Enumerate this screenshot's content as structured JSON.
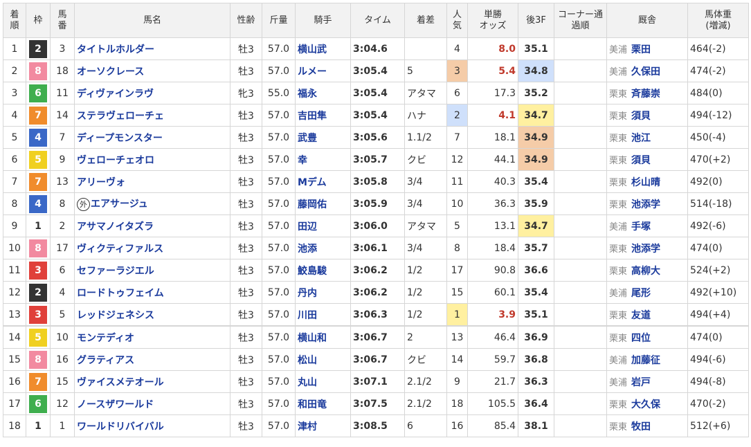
{
  "headers": {
    "pos": "着順",
    "waku": "枠",
    "num": "馬番",
    "name": "馬名",
    "sexage": "性齢",
    "weight": "斤量",
    "jockey": "騎手",
    "time": "タイム",
    "margin": "着差",
    "pop": "人気",
    "odds": "単勝オッズ",
    "last3f": "後3F",
    "corner": "コーナー通過順",
    "trainer": "厩舎",
    "bodyweight": "馬体重(増減)"
  },
  "colors": {
    "waku": {
      "1": "#ffffff",
      "2": "#333333",
      "3": "#e0403a",
      "4": "#3a68c7",
      "5": "#f0d020",
      "6": "#3fae4e",
      "7": "#f08c2c",
      "8": "#f28aa0"
    },
    "waku_text": {
      "1": "#333333",
      "2": "#ffffff",
      "3": "#ffffff",
      "4": "#ffffff",
      "5": "#ffffff",
      "6": "#ffffff",
      "7": "#ffffff",
      "8": "#ffffff"
    },
    "pop_rank_1": "#fff0a0",
    "pop_rank_2": "#cfe0fb",
    "pop_rank_3": "#f5cca8",
    "last3f_rank_1": "#fff0a0",
    "last3f_rank_2": "#cfe0fb",
    "last3f_rank_3": "#f5cca8"
  },
  "rows": [
    {
      "pos": "1",
      "waku": "2",
      "num": "3",
      "name": "タイトルホルダー",
      "gaiji": false,
      "sexage": "牡3",
      "weight": "57.0",
      "jockey": "横山武",
      "time": "3:04.6",
      "margin": "",
      "pop": "4",
      "odds": "8.0",
      "fav": true,
      "last3f": "35.1",
      "corner": "",
      "region": "美浦",
      "trainer": "栗田",
      "bodyweight": "464(-2)"
    },
    {
      "pos": "2",
      "waku": "8",
      "num": "18",
      "name": "オーソクレース",
      "gaiji": false,
      "sexage": "牡3",
      "weight": "57.0",
      "jockey": "ルメー",
      "time": "3:05.4",
      "margin": "5",
      "pop": "3",
      "odds": "5.4",
      "fav": true,
      "last3f": "34.8",
      "corner": "",
      "region": "美浦",
      "trainer": "久保田",
      "bodyweight": "474(-2)"
    },
    {
      "pos": "3",
      "waku": "6",
      "num": "11",
      "name": "ディヴァインラヴ",
      "gaiji": false,
      "sexage": "牝3",
      "weight": "55.0",
      "jockey": "福永",
      "time": "3:05.4",
      "margin": "アタマ",
      "pop": "6",
      "odds": "17.3",
      "fav": false,
      "last3f": "35.2",
      "corner": "",
      "region": "栗東",
      "trainer": "斉藤崇",
      "bodyweight": "484(0)"
    },
    {
      "pos": "4",
      "waku": "7",
      "num": "14",
      "name": "ステラヴェローチェ",
      "gaiji": false,
      "sexage": "牡3",
      "weight": "57.0",
      "jockey": "吉田隼",
      "time": "3:05.4",
      "margin": "ハナ",
      "pop": "2",
      "odds": "4.1",
      "fav": true,
      "last3f": "34.7",
      "corner": "",
      "region": "栗東",
      "trainer": "須貝",
      "bodyweight": "494(-12)"
    },
    {
      "pos": "5",
      "waku": "4",
      "num": "7",
      "name": "ディープモンスター",
      "gaiji": false,
      "sexage": "牡3",
      "weight": "57.0",
      "jockey": "武豊",
      "time": "3:05.6",
      "margin": "1.1/2",
      "pop": "7",
      "odds": "18.1",
      "fav": false,
      "last3f": "34.9",
      "corner": "",
      "region": "栗東",
      "trainer": "池江",
      "bodyweight": "450(-4)"
    },
    {
      "pos": "6",
      "waku": "5",
      "num": "9",
      "name": "ヴェローチェオロ",
      "gaiji": false,
      "sexage": "牡3",
      "weight": "57.0",
      "jockey": "幸",
      "time": "3:05.7",
      "margin": "クビ",
      "pop": "12",
      "odds": "44.1",
      "fav": false,
      "last3f": "34.9",
      "corner": "",
      "region": "栗東",
      "trainer": "須貝",
      "bodyweight": "470(+2)"
    },
    {
      "pos": "7",
      "waku": "7",
      "num": "13",
      "name": "アリーヴォ",
      "gaiji": false,
      "sexage": "牡3",
      "weight": "57.0",
      "jockey": "Mデム",
      "time": "3:05.8",
      "margin": "3/4",
      "pop": "11",
      "odds": "40.3",
      "fav": false,
      "last3f": "35.4",
      "corner": "",
      "region": "栗東",
      "trainer": "杉山晴",
      "bodyweight": "492(0)"
    },
    {
      "pos": "8",
      "waku": "4",
      "num": "8",
      "name": "エアサージュ",
      "gaiji": true,
      "gaiji_mark": "外",
      "sexage": "牡3",
      "weight": "57.0",
      "jockey": "藤岡佑",
      "time": "3:05.9",
      "margin": "3/4",
      "pop": "10",
      "odds": "36.3",
      "fav": false,
      "last3f": "35.9",
      "corner": "",
      "region": "栗東",
      "trainer": "池添学",
      "bodyweight": "514(-18)"
    },
    {
      "pos": "9",
      "waku": "1",
      "num": "2",
      "name": "アサマノイタズラ",
      "gaiji": false,
      "sexage": "牡3",
      "weight": "57.0",
      "jockey": "田辺",
      "time": "3:06.0",
      "margin": "アタマ",
      "pop": "5",
      "odds": "13.1",
      "fav": false,
      "last3f": "34.7",
      "corner": "",
      "region": "美浦",
      "trainer": "手塚",
      "bodyweight": "492(-6)"
    },
    {
      "pos": "10",
      "waku": "8",
      "num": "17",
      "name": "ヴィクティファルス",
      "gaiji": false,
      "sexage": "牡3",
      "weight": "57.0",
      "jockey": "池添",
      "time": "3:06.1",
      "margin": "3/4",
      "pop": "8",
      "odds": "18.4",
      "fav": false,
      "last3f": "35.7",
      "corner": "",
      "region": "栗東",
      "trainer": "池添学",
      "bodyweight": "474(0)"
    },
    {
      "pos": "11",
      "waku": "3",
      "num": "6",
      "name": "セファーラジエル",
      "gaiji": false,
      "sexage": "牡3",
      "weight": "57.0",
      "jockey": "鮫島駿",
      "time": "3:06.2",
      "margin": "1/2",
      "pop": "17",
      "odds": "90.8",
      "fav": false,
      "last3f": "36.6",
      "corner": "",
      "region": "栗東",
      "trainer": "高柳大",
      "bodyweight": "524(+2)"
    },
    {
      "pos": "12",
      "waku": "2",
      "num": "4",
      "name": "ロードトゥフェイム",
      "gaiji": false,
      "sexage": "牡3",
      "weight": "57.0",
      "jockey": "丹内",
      "time": "3:06.2",
      "margin": "1/2",
      "pop": "15",
      "odds": "60.1",
      "fav": false,
      "last3f": "35.4",
      "corner": "",
      "region": "美浦",
      "trainer": "尾形",
      "bodyweight": "492(+10)"
    },
    {
      "pos": "13",
      "waku": "3",
      "num": "5",
      "name": "レッドジェネシス",
      "gaiji": false,
      "sexage": "牡3",
      "weight": "57.0",
      "jockey": "川田",
      "time": "3:06.3",
      "margin": "1/2",
      "pop": "1",
      "odds": "3.9",
      "fav": true,
      "last3f": "35.1",
      "corner": "",
      "region": "栗東",
      "trainer": "友道",
      "bodyweight": "494(+4)"
    },
    {
      "pos": "14",
      "waku": "5",
      "num": "10",
      "name": "モンテディオ",
      "gaiji": false,
      "sexage": "牡3",
      "weight": "57.0",
      "jockey": "横山和",
      "time": "3:06.7",
      "margin": "2",
      "pop": "13",
      "odds": "46.4",
      "fav": false,
      "last3f": "36.9",
      "corner": "",
      "region": "栗東",
      "trainer": "四位",
      "bodyweight": "474(0)"
    },
    {
      "pos": "15",
      "waku": "8",
      "num": "16",
      "name": "グラティアス",
      "gaiji": false,
      "sexage": "牡3",
      "weight": "57.0",
      "jockey": "松山",
      "time": "3:06.7",
      "margin": "クビ",
      "pop": "14",
      "odds": "59.7",
      "fav": false,
      "last3f": "36.8",
      "corner": "",
      "region": "美浦",
      "trainer": "加藤征",
      "bodyweight": "494(-6)"
    },
    {
      "pos": "16",
      "waku": "7",
      "num": "15",
      "name": "ヴァイスメテオール",
      "gaiji": false,
      "sexage": "牡3",
      "weight": "57.0",
      "jockey": "丸山",
      "time": "3:07.1",
      "margin": "2.1/2",
      "pop": "9",
      "odds": "21.7",
      "fav": false,
      "last3f": "36.3",
      "corner": "",
      "region": "美浦",
      "trainer": "岩戸",
      "bodyweight": "494(-8)"
    },
    {
      "pos": "17",
      "waku": "6",
      "num": "12",
      "name": "ノースザワールド",
      "gaiji": false,
      "sexage": "牡3",
      "weight": "57.0",
      "jockey": "和田竜",
      "time": "3:07.5",
      "margin": "2.1/2",
      "pop": "18",
      "odds": "105.5",
      "fav": false,
      "last3f": "36.4",
      "corner": "",
      "region": "栗東",
      "trainer": "大久保",
      "bodyweight": "470(-2)"
    },
    {
      "pos": "18",
      "waku": "1",
      "num": "1",
      "name": "ワールドリバイバル",
      "gaiji": false,
      "sexage": "牡3",
      "weight": "57.0",
      "jockey": "津村",
      "time": "3:08.5",
      "margin": "6",
      "pop": "16",
      "odds": "85.4",
      "fav": false,
      "last3f": "38.1",
      "corner": "",
      "region": "栗東",
      "trainer": "牧田",
      "bodyweight": "512(+6)"
    }
  ]
}
